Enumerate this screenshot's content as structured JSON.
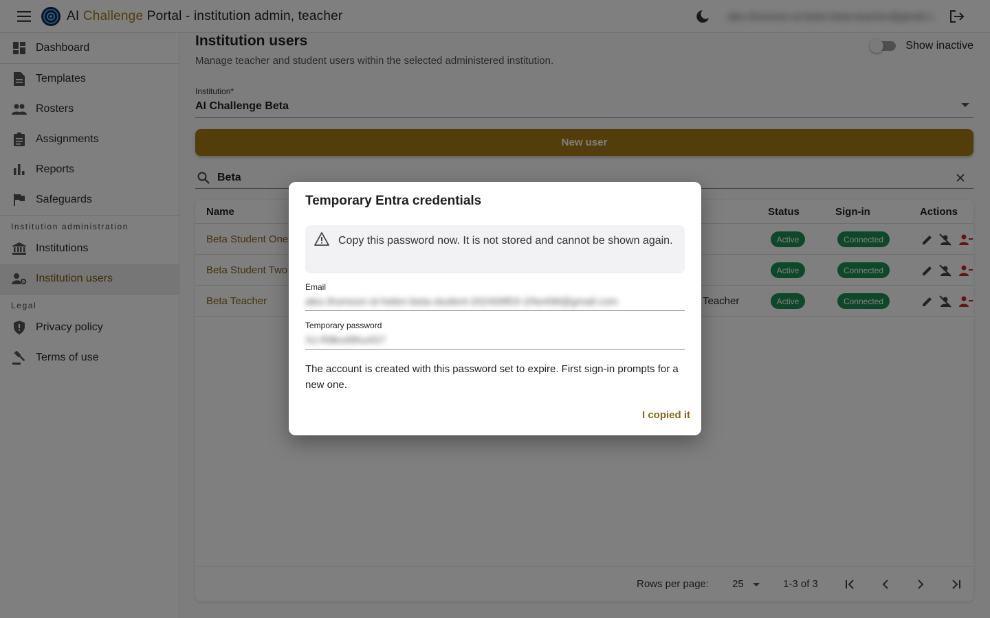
{
  "app": {
    "title_prefix": "AI ",
    "title_accent": "Challenge",
    "title_suffix": " Portal - institution admin, teacher",
    "user_email": "alex.thomson-st.helen-beta-teacher@gmail.com"
  },
  "sidebar": {
    "items": [
      {
        "label": "Dashboard",
        "icon": "dashboard-icon"
      },
      {
        "label": "Templates",
        "icon": "document-icon"
      },
      {
        "label": "Rosters",
        "icon": "people-icon"
      },
      {
        "label": "Assignments",
        "icon": "assignment-icon"
      },
      {
        "label": "Reports",
        "icon": "bar-chart-icon"
      },
      {
        "label": "Safeguards",
        "icon": "flag-icon"
      }
    ],
    "section_admin": "Institution administration",
    "admin_items": [
      {
        "label": "Institutions",
        "icon": "bank-icon"
      },
      {
        "label": "Institution users",
        "icon": "manage-accounts-icon",
        "active": true
      }
    ],
    "section_legal": "Legal",
    "legal_items": [
      {
        "label": "Privacy policy",
        "icon": "shield-icon"
      },
      {
        "label": "Terms of use",
        "icon": "gavel-icon"
      }
    ]
  },
  "main": {
    "title": "Institution users",
    "subtitle": "Manage teacher and student users within the selected administered institution.",
    "show_inactive_label": "Show inactive",
    "show_inactive_on": false,
    "institution_label": "Institution*",
    "institution_value": "AI Challenge Beta",
    "new_user_label": "New user",
    "search_value": "Beta"
  },
  "table": {
    "headers": {
      "name": "Name",
      "status": "Status",
      "signin": "Sign-in",
      "actions": "Actions"
    },
    "rows": [
      {
        "name": "Beta Student One",
        "role": "",
        "status": "Active",
        "signin": "Connected"
      },
      {
        "name": "Beta Student Two",
        "role": "",
        "status": "Active",
        "signin": "Connected"
      },
      {
        "name": "Beta Teacher",
        "role": "Teacher",
        "status": "Active",
        "signin": "Connected"
      }
    ],
    "rows_per_page_label": "Rows per page:",
    "rows_per_page": "25",
    "range": "1-3 of 3"
  },
  "dialog": {
    "title": "Temporary Entra credentials",
    "alert": "Copy this password now. It is not stored and cannot be shown again.",
    "email_label": "Email",
    "email_value": "alex.thomson-st-helen-beta-student-202409f03-1f4e498@gmail.com",
    "password_label": "Temporary password",
    "password_value": "Xz-R8kvd9hu4S7",
    "note": "The account is created with this password set to expire. First sign-in prompts for a new one.",
    "confirm_label": "I copied it"
  },
  "colors": {
    "accent": "#a57a16",
    "link": "#8a6614",
    "status_green": "#1f8f55",
    "danger": "#c62828"
  }
}
